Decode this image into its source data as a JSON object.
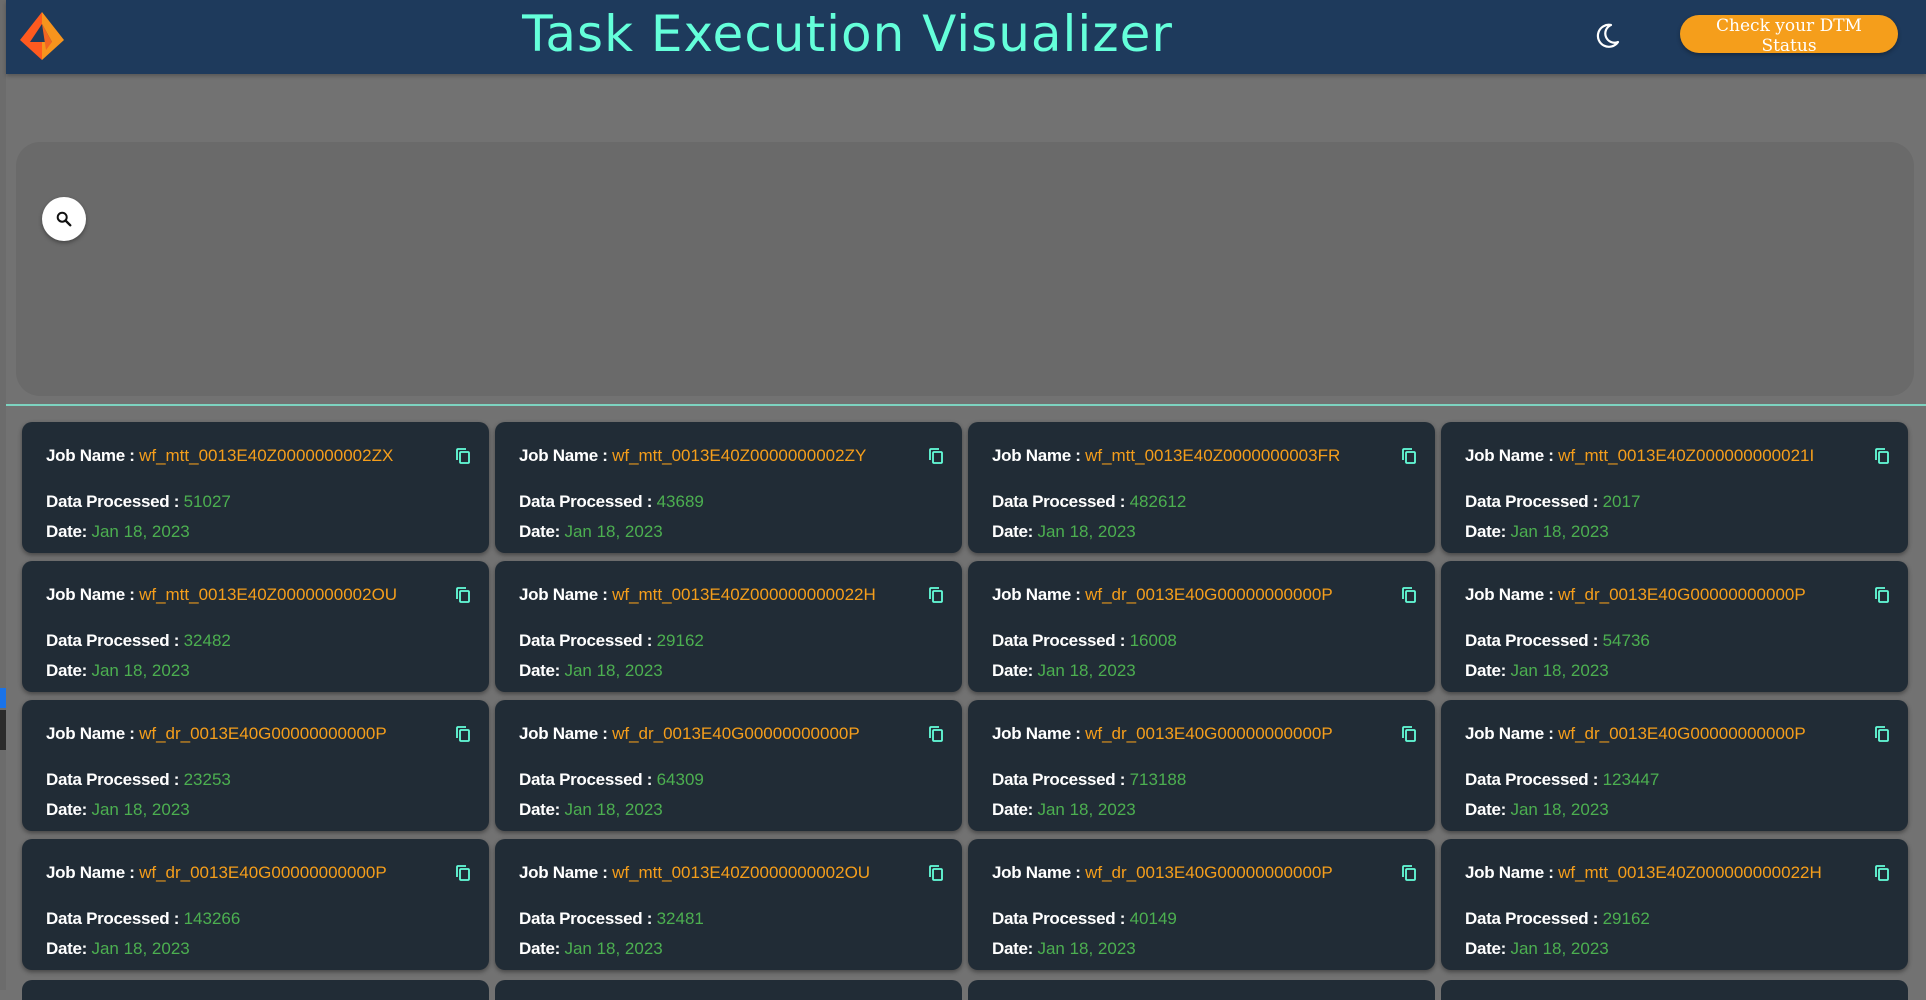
{
  "header": {
    "title": "Task Execution Visualizer",
    "dtm_button_label": "Check your DTM Status",
    "logo_icon": "informatica-logo-icon",
    "theme_icon": "moon-icon"
  },
  "search": {
    "icon": "search-icon"
  },
  "card_labels": {
    "job_name": "Job Name :",
    "data_processed": "Data Processed :",
    "date": "Date:"
  },
  "colors": {
    "header_bg": "#1e3a5c",
    "title": "#64ffda",
    "accent_orange": "#f59e1b",
    "value_green": "#4caf50",
    "card_bg": "#212c36"
  },
  "cards": [
    {
      "job_name": "wf_mtt_0013E40Z0000000002ZX",
      "data_processed": "51027",
      "date": "Jan 18, 2023"
    },
    {
      "job_name": "wf_mtt_0013E40Z0000000002ZY",
      "data_processed": "43689",
      "date": "Jan 18, 2023"
    },
    {
      "job_name": "wf_mtt_0013E40Z0000000003FR",
      "data_processed": "482612",
      "date": "Jan 18, 2023"
    },
    {
      "job_name": "wf_mtt_0013E40Z000000000021I",
      "data_processed": "2017",
      "date": "Jan 18, 2023"
    },
    {
      "job_name": "wf_mtt_0013E40Z0000000002OU",
      "data_processed": "32482",
      "date": "Jan 18, 2023"
    },
    {
      "job_name": "wf_mtt_0013E40Z000000000022H",
      "data_processed": "29162",
      "date": "Jan 18, 2023"
    },
    {
      "job_name": "wf_dr_0013E40G00000000000P",
      "data_processed": "16008",
      "date": "Jan 18, 2023"
    },
    {
      "job_name": "wf_dr_0013E40G00000000000P",
      "data_processed": "54736",
      "date": "Jan 18, 2023"
    },
    {
      "job_name": "wf_dr_0013E40G00000000000P",
      "data_processed": "23253",
      "date": "Jan 18, 2023"
    },
    {
      "job_name": "wf_dr_0013E40G00000000000P",
      "data_processed": "64309",
      "date": "Jan 18, 2023"
    },
    {
      "job_name": "wf_dr_0013E40G00000000000P",
      "data_processed": "713188",
      "date": "Jan 18, 2023"
    },
    {
      "job_name": "wf_dr_0013E40G00000000000P",
      "data_processed": "123447",
      "date": "Jan 18, 2023"
    },
    {
      "job_name": "wf_dr_0013E40G00000000000P",
      "data_processed": "143266",
      "date": "Jan 18, 2023"
    },
    {
      "job_name": "wf_mtt_0013E40Z0000000002OU",
      "data_processed": "32481",
      "date": "Jan 18, 2023"
    },
    {
      "job_name": "wf_dr_0013E40G00000000000P",
      "data_processed": "40149",
      "date": "Jan 18, 2023"
    },
    {
      "job_name": "wf_mtt_0013E40Z000000000022H",
      "data_processed": "29162",
      "date": "Jan 18, 2023"
    }
  ]
}
